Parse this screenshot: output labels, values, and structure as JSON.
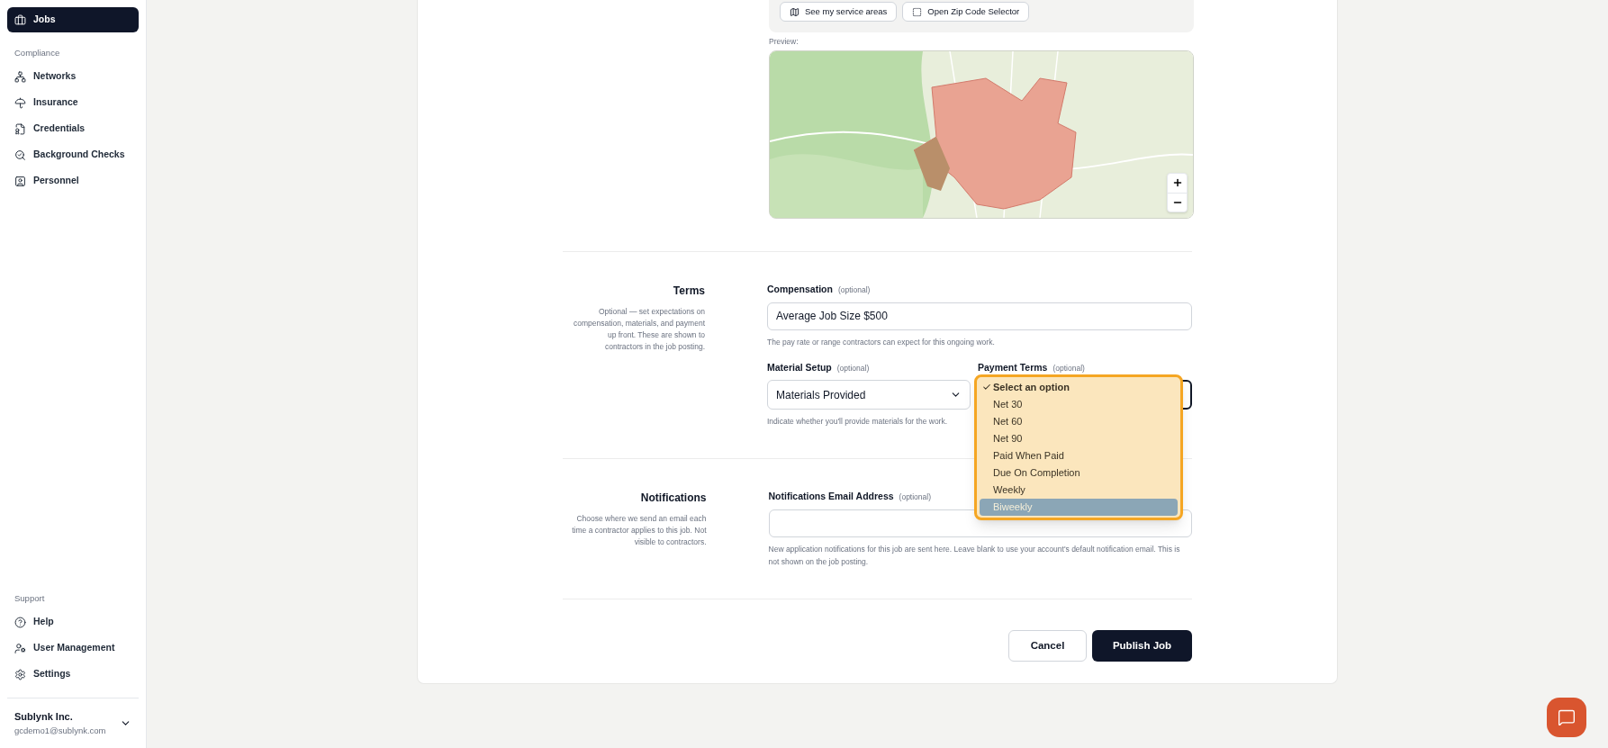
{
  "sidebar": {
    "top_items": [
      {
        "label": "Jobs",
        "selected": true
      }
    ],
    "sections": [
      {
        "title": "Compliance",
        "items": [
          {
            "label": "Networks",
            "selected": false
          },
          {
            "label": "Insurance",
            "selected": false
          },
          {
            "label": "Credentials",
            "selected": false
          },
          {
            "label": "Background Checks",
            "selected": false
          },
          {
            "label": "Personnel",
            "selected": false
          }
        ]
      },
      {
        "title": "Support",
        "items": [
          {
            "label": "Help",
            "selected": false
          },
          {
            "label": "User Management",
            "selected": false
          },
          {
            "label": "Settings",
            "selected": false
          }
        ]
      }
    ],
    "account": {
      "name": "Sublynk Inc.",
      "email": "gcdemo1@sublynk.com"
    }
  },
  "service_area": {
    "buttons": [
      "See my service areas",
      "Open Zip Code Selector"
    ],
    "preview_label": "Preview:"
  },
  "terms": {
    "title": "Terms",
    "description": "Optional — set expectations on compensation, materials, and payment up front. These are shown to contractors in the job posting.",
    "compensation": {
      "label": "Compensation",
      "optional": "(optional)",
      "value": "Average Job Size $500",
      "help": "The pay rate or range contractors can expect for this ongoing work."
    },
    "material_setup": {
      "label": "Material Setup",
      "optional": "(optional)",
      "value": "Materials Provided",
      "help": "Indicate whether you'll provide materials for the work."
    },
    "payment_terms": {
      "label": "Payment Terms",
      "optional": "(optional)",
      "expanded": true,
      "options": [
        {
          "label": "Select an option",
          "selected": true,
          "highlighted": false
        },
        {
          "label": "Net 30",
          "selected": false,
          "highlighted": false
        },
        {
          "label": "Net 60",
          "selected": false,
          "highlighted": false
        },
        {
          "label": "Net 90",
          "selected": false,
          "highlighted": false
        },
        {
          "label": "Paid When Paid",
          "selected": false,
          "highlighted": false
        },
        {
          "label": "Due On Completion",
          "selected": false,
          "highlighted": false
        },
        {
          "label": "Weekly",
          "selected": false,
          "highlighted": false
        },
        {
          "label": "Biweekly",
          "selected": false,
          "highlighted": true
        }
      ]
    }
  },
  "notifications": {
    "title": "Notifications",
    "description": "Choose where we send an email each time a contractor applies to this job. Not visible to contractors.",
    "email": {
      "label": "Notifications Email Address",
      "optional": "(optional)",
      "help": "New application notifications for this job are sent here. Leave blank to use your account's default notification email. This is not shown on the job posting."
    }
  },
  "actions": {
    "cancel": "Cancel",
    "publish": "Publish Job"
  }
}
